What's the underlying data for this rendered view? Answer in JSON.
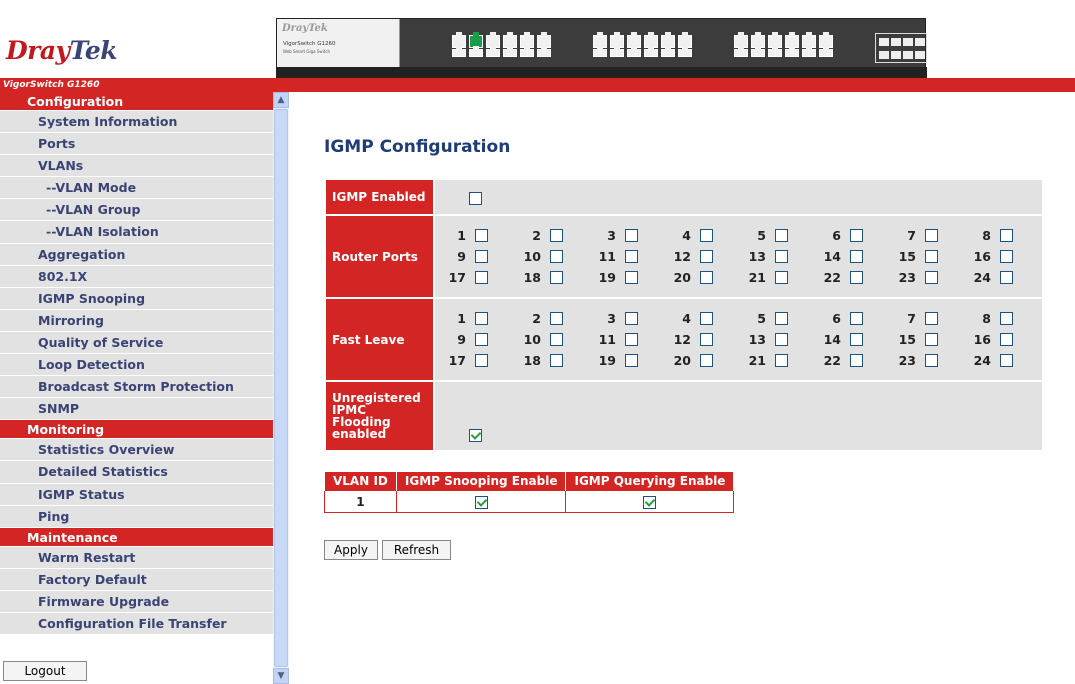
{
  "header": {
    "brand_part1": "Dray",
    "brand_part2": "Tek",
    "model": "VigorSwitch G1260",
    "panel_logo": "DrayTek",
    "panel_model": "VigorSwitch G1260",
    "panel_sub": "Web Smart Giga Switch"
  },
  "sidebar": {
    "sections": [
      {
        "title": "Configuration",
        "items": [
          {
            "label": "System Information",
            "sub": false
          },
          {
            "label": "Ports",
            "sub": false
          },
          {
            "label": "VLANs",
            "sub": false
          },
          {
            "label": "--VLAN Mode",
            "sub": true
          },
          {
            "label": "--VLAN Group",
            "sub": true
          },
          {
            "label": "--VLAN Isolation",
            "sub": true
          },
          {
            "label": "Aggregation",
            "sub": false
          },
          {
            "label": "802.1X",
            "sub": false
          },
          {
            "label": "IGMP Snooping",
            "sub": false
          },
          {
            "label": "Mirroring",
            "sub": false
          },
          {
            "label": "Quality of Service",
            "sub": false
          },
          {
            "label": "Loop Detection",
            "sub": false
          },
          {
            "label": "Broadcast Storm Protection",
            "sub": false
          },
          {
            "label": "SNMP",
            "sub": false
          }
        ]
      },
      {
        "title": "Monitoring",
        "items": [
          {
            "label": "Statistics Overview",
            "sub": false
          },
          {
            "label": "Detailed Statistics",
            "sub": false
          },
          {
            "label": "IGMP Status",
            "sub": false
          },
          {
            "label": "Ping",
            "sub": false
          }
        ]
      },
      {
        "title": "Maintenance",
        "items": [
          {
            "label": "Warm Restart",
            "sub": false
          },
          {
            "label": "Factory Default",
            "sub": false
          },
          {
            "label": "Firmware Upgrade",
            "sub": false
          },
          {
            "label": "Configuration File Transfer",
            "sub": false
          }
        ]
      }
    ],
    "logout_label": "Logout"
  },
  "main": {
    "title": "IGMP Configuration",
    "igmp_enabled": {
      "label": "IGMP Enabled",
      "checked": false
    },
    "router_ports": {
      "label": "Router Ports",
      "ports": [
        1,
        2,
        3,
        4,
        5,
        6,
        7,
        8,
        9,
        10,
        11,
        12,
        13,
        14,
        15,
        16,
        17,
        18,
        19,
        20,
        21,
        22,
        23,
        24
      ],
      "checked": []
    },
    "fast_leave": {
      "label": "Fast Leave",
      "ports": [
        1,
        2,
        3,
        4,
        5,
        6,
        7,
        8,
        9,
        10,
        11,
        12,
        13,
        14,
        15,
        16,
        17,
        18,
        19,
        20,
        21,
        22,
        23,
        24
      ],
      "checked": []
    },
    "unregistered_flooding": {
      "label": "Unregistered IPMC Flooding enabled",
      "checked": true
    },
    "vlan_table": {
      "headers": [
        "VLAN ID",
        "IGMP Snooping Enable",
        "IGMP Querying Enable"
      ],
      "rows": [
        {
          "vlan_id": "1",
          "snooping": true,
          "querying": true
        }
      ]
    },
    "apply_label": "Apply",
    "refresh_label": "Refresh"
  },
  "colors": {
    "accent_red": "#d42525",
    "nav_text": "#3a4474",
    "title_blue": "#1f3c76",
    "row_gray": "#e2e2e2",
    "scrollbar_blue": "#c2d3f5"
  },
  "icons": {
    "scroll_up": "chevron-up-icon",
    "scroll_down": "chevron-down-icon"
  }
}
